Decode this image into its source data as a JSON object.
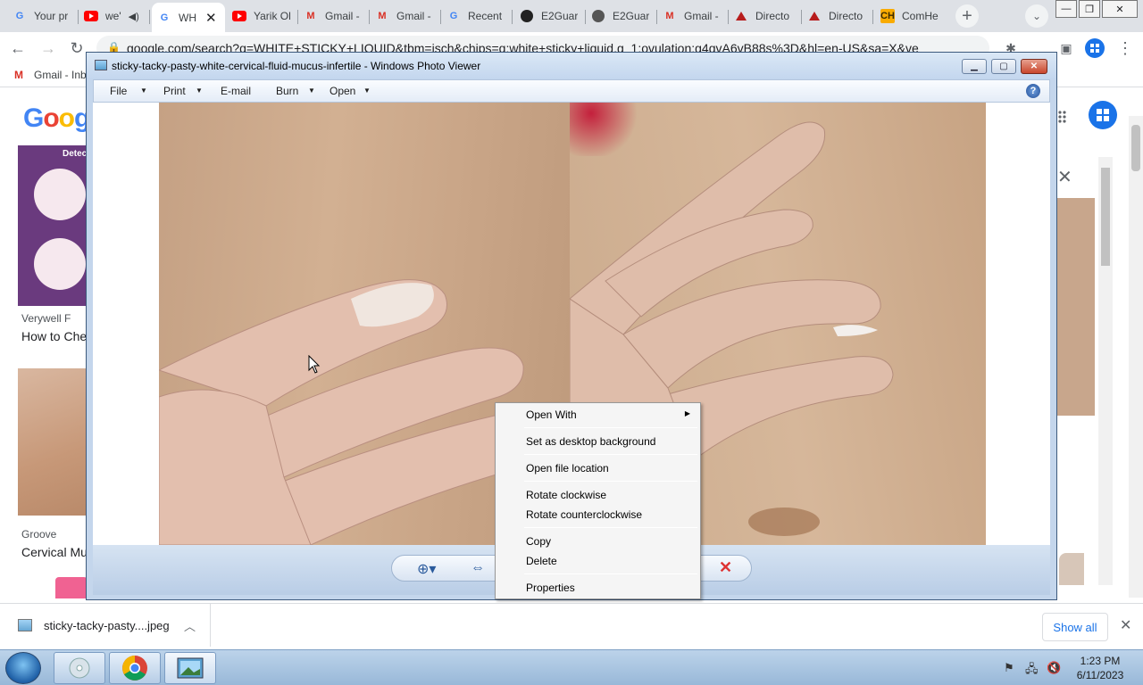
{
  "browser": {
    "tabs": [
      {
        "title": "Your pr",
        "icon": "google-icon"
      },
      {
        "title": "we'",
        "icon": "youtube-icon"
      },
      {
        "title": "WH",
        "icon": "google-icon",
        "active": true
      },
      {
        "title": "Yarik Ol",
        "icon": "youtube-icon"
      },
      {
        "title": "Gmail -",
        "icon": "gmail-icon"
      },
      {
        "title": "Gmail -",
        "icon": "gmail-icon"
      },
      {
        "title": "Recent",
        "icon": "google-icon"
      },
      {
        "title": "E2Guar",
        "icon": "github-icon"
      },
      {
        "title": "E2Guar",
        "icon": "github-icon"
      },
      {
        "title": "Gmail -",
        "icon": "gmail-icon"
      },
      {
        "title": "Directo",
        "icon": "directory-icon"
      },
      {
        "title": "Directo",
        "icon": "directory-icon"
      },
      {
        "title": "ComHe",
        "icon": "comhe-icon"
      }
    ],
    "url": "google.com/search?q=WHITE+STICKY+LIQUID&tbm=isch&chips=q:white+sticky+liquid,g_1:ovulation:g4qvA6vB88s%3D&hl=en-US&sa=X&ve",
    "bookmark": "Gmail - Inb"
  },
  "google": {
    "logo": "Goog",
    "results": [
      {
        "source": "Verywell F",
        "title": "How to Che"
      },
      {
        "source": "Groove",
        "title": "Cervical Mu"
      }
    ],
    "thumb_label": "Detect"
  },
  "photo_viewer": {
    "title": "sticky-tacky-pasty-white-cervical-fluid-mucus-infertile - Windows Photo Viewer",
    "menu": [
      "File",
      "Print",
      "E-mail",
      "Burn",
      "Open"
    ],
    "help": "?"
  },
  "context_menu": {
    "items": [
      "Open With",
      "Set as desktop background",
      "Open file location",
      "Rotate clockwise",
      "Rotate counterclockwise",
      "Copy",
      "Delete",
      "Properties"
    ]
  },
  "downloads": {
    "file": "sticky-tacky-pasty....jpeg",
    "show_all": "Show all"
  },
  "taskbar": {
    "time": "1:23 PM",
    "date": "6/11/2023"
  }
}
